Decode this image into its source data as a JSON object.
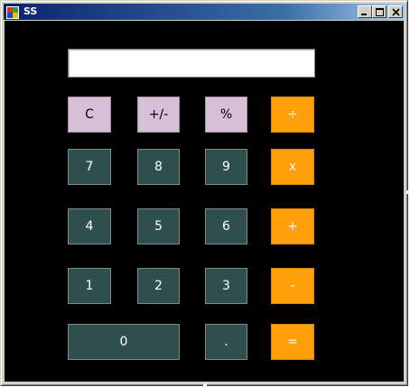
{
  "window": {
    "title": "SS",
    "icon": "app-window-icon",
    "controls": [
      {
        "name": "minimize",
        "icon": "minimize-icon"
      },
      {
        "name": "maximize",
        "icon": "maximize-icon"
      },
      {
        "name": "close",
        "icon": "close-icon"
      }
    ]
  },
  "display": {
    "value": ""
  },
  "keys": {
    "clear": "C",
    "sign": "+/-",
    "percent": "%",
    "divide": "÷",
    "seven": "7",
    "eight": "8",
    "nine": "9",
    "multiply": "x",
    "four": "4",
    "five": "5",
    "six": "6",
    "add": "+",
    "one": "1",
    "two": "2",
    "three": "3",
    "subtract": "-",
    "zero": "0",
    "decimal": ".",
    "equals": "="
  },
  "colors": {
    "background": "#000000",
    "function_key": "#d8bfd8",
    "number_key": "#2f4f4f",
    "operator_key": "#ff9f0a",
    "titlebar_start": "#0a246a",
    "titlebar_end": "#a6caf0"
  }
}
